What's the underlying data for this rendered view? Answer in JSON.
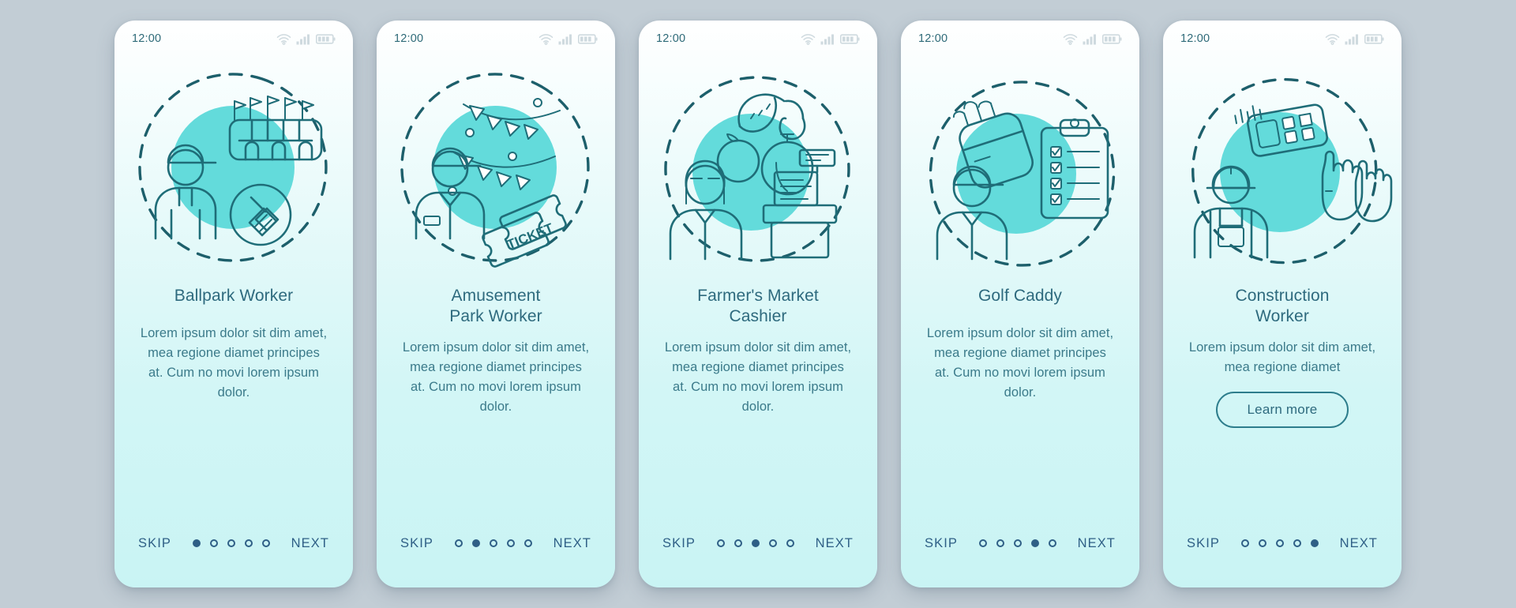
{
  "background_color": "#c2cdd5",
  "theme": {
    "accent": "#63dbdb",
    "line": "#1f6d78",
    "title_color": "#2e6a7e",
    "body_color": "#3b7a8a",
    "nav_color": "#2f5f86",
    "card_gradient_top": "#ffffff",
    "card_gradient_bottom": "#c9f4f4"
  },
  "status_bar": {
    "time": "12:00",
    "icons": [
      "wifi-icon",
      "cellular-signal-icon",
      "battery-icon"
    ]
  },
  "nav": {
    "skip_label": "SKIP",
    "next_label": "NEXT",
    "total_steps": 5
  },
  "screens": [
    {
      "id": "ballpark-worker",
      "title": "Ballpark Worker",
      "title_lines": [
        "Ballpark Worker"
      ],
      "body": "Lorem ipsum dolor sit dim amet, mea regione diamet principes at. Cum no movi lorem ipsum dolor.",
      "active_step": 1,
      "illustration": "ballpark-worker-illustration",
      "has_learn_more": false
    },
    {
      "id": "amusement-park-worker",
      "title": "Amusement Park Worker",
      "title_lines": [
        "Amusement",
        "Park Worker"
      ],
      "body": "Lorem ipsum dolor sit dim amet, mea regione diamet principes at. Cum no movi lorem ipsum dolor.",
      "active_step": 2,
      "illustration": "amusement-park-worker-illustration",
      "ticket_label": "TICKET",
      "has_learn_more": false
    },
    {
      "id": "farmers-market-cashier",
      "title": "Farmer's Market Cashier",
      "title_lines": [
        "Farmer's Market",
        "Cashier"
      ],
      "body": "Lorem ipsum dolor sit dim amet, mea regione diamet principes at. Cum no movi lorem ipsum dolor.",
      "active_step": 3,
      "illustration": "farmers-market-cashier-illustration",
      "has_learn_more": false
    },
    {
      "id": "golf-caddy",
      "title": "Golf Caddy",
      "title_lines": [
        "Golf Caddy"
      ],
      "body": "Lorem ipsum dolor sit dim amet, mea regione diamet principes at. Cum no movi lorem ipsum dolor.",
      "active_step": 4,
      "illustration": "golf-caddy-illustration",
      "has_learn_more": false
    },
    {
      "id": "construction-worker",
      "title": "Construction Worker",
      "title_lines": [
        "Construction",
        "Worker"
      ],
      "body": "Lorem ipsum dolor sit dim amet, mea regione diamet",
      "active_step": 5,
      "illustration": "construction-worker-illustration",
      "has_learn_more": true,
      "learn_more_label": "Learn more"
    }
  ]
}
